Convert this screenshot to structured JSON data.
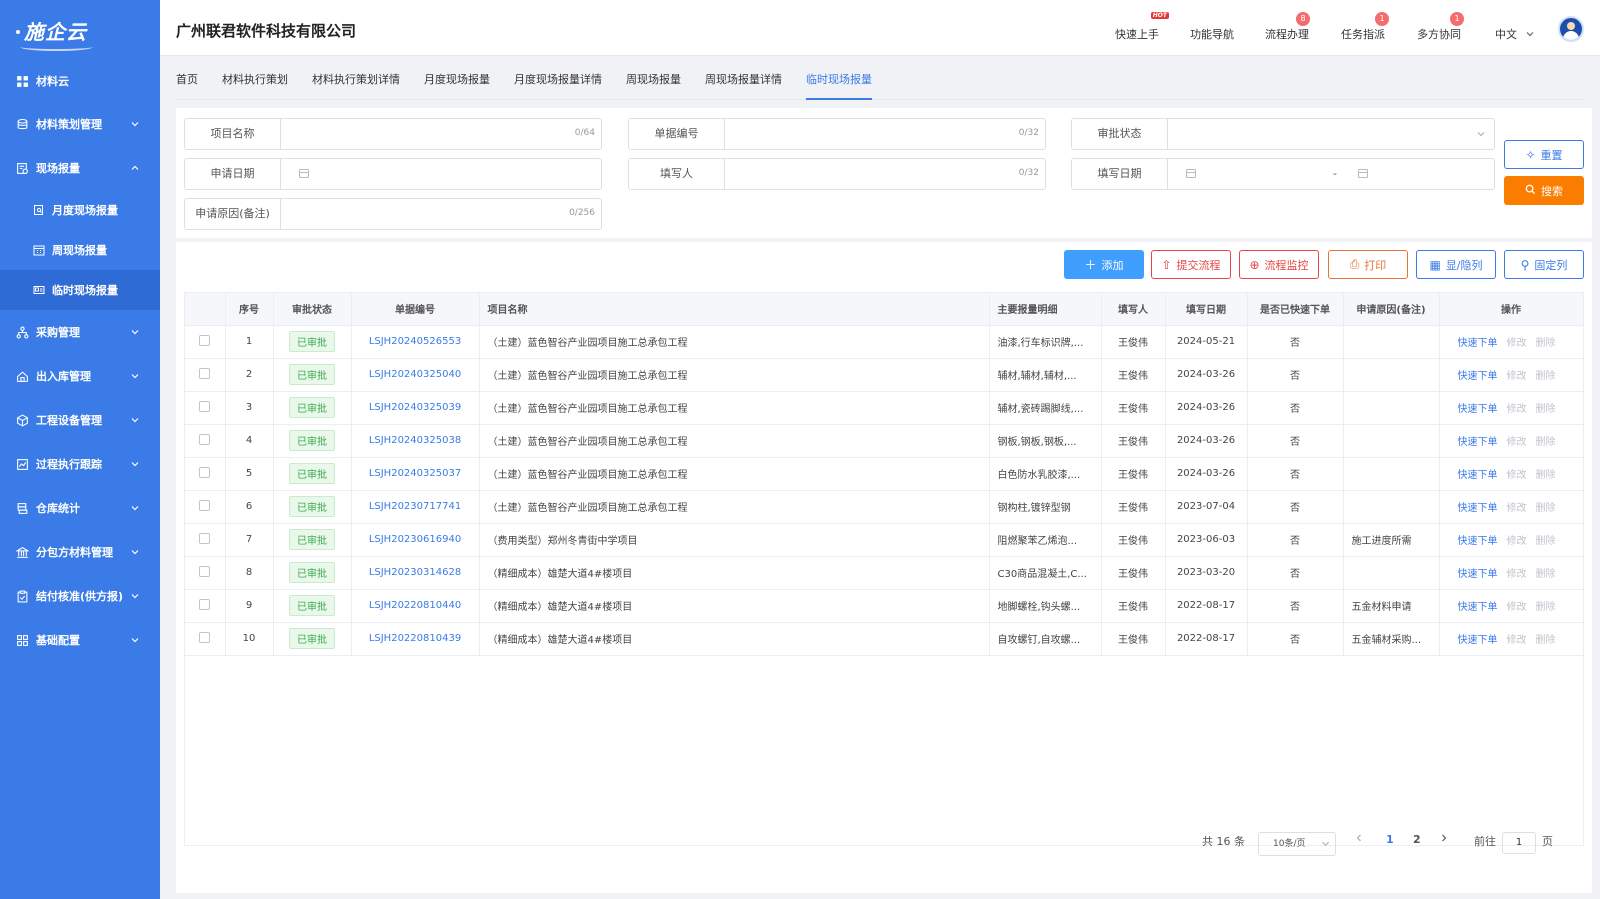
{
  "logo": {
    "text": "施企云"
  },
  "sidebar": {
    "top": {
      "label": "材料云"
    },
    "items": [
      {
        "label": "材料策划管理",
        "icon": "database-icon",
        "expanded": false
      },
      {
        "label": "现场报量",
        "icon": "report-icon",
        "expanded": true,
        "children": [
          {
            "label": "月度现场报量",
            "icon": "doc-search-icon",
            "active": false
          },
          {
            "label": "周现场报量",
            "icon": "calendar-icon",
            "active": false
          },
          {
            "label": "临时现场报量",
            "icon": "card-icon",
            "active": true
          }
        ]
      },
      {
        "label": "采购管理",
        "icon": "network-icon",
        "expanded": false
      },
      {
        "label": "出入库管理",
        "icon": "home-icon",
        "expanded": false
      },
      {
        "label": "工程设备管理",
        "icon": "cube-icon",
        "expanded": false
      },
      {
        "label": "过程执行跟踪",
        "icon": "track-icon",
        "expanded": false
      },
      {
        "label": "仓库统计",
        "icon": "stack-icon",
        "expanded": false
      },
      {
        "label": "分包方材料管理",
        "icon": "bank-icon",
        "expanded": false
      },
      {
        "label": "结付核准(供方报)",
        "icon": "clipboard-check-icon",
        "expanded": false
      },
      {
        "label": "基础配置",
        "icon": "grid-icon",
        "expanded": false
      }
    ]
  },
  "header": {
    "company": "广州联君软件科技有限公司",
    "links": [
      {
        "label": "快速上手",
        "tag": "HOT"
      },
      {
        "label": "功能导航"
      },
      {
        "label": "流程办理",
        "badge": "8"
      },
      {
        "label": "任务指派",
        "badge": "1"
      },
      {
        "label": "多方协同",
        "badge": "1"
      }
    ],
    "language": "中文"
  },
  "tabs": [
    "首页",
    "材料执行策划",
    "材料执行策划详情",
    "月度现场报量",
    "月度现场报量详情",
    "周现场报量",
    "周现场报量详情",
    "临时现场报量"
  ],
  "active_tab": 7,
  "filters": {
    "project_name": {
      "label": "项目名称",
      "count": "0/64"
    },
    "doc_no": {
      "label": "单据编号",
      "count": "0/32"
    },
    "approval_status": {
      "label": "审批状态"
    },
    "apply_date": {
      "label": "申请日期"
    },
    "filler": {
      "label": "填写人",
      "count": "0/32"
    },
    "fill_date": {
      "label": "填写日期",
      "separator": "-"
    },
    "apply_reason": {
      "label": "申请原因(备注)",
      "count": "0/256"
    },
    "reset_label": "重置",
    "search_label": "搜索"
  },
  "toolbar": {
    "add": "添加",
    "submit_flow": "提交流程",
    "flow_monitor": "流程监控",
    "print": "打印",
    "show_hide_cols": "显/隐列",
    "fix_cols": "固定列"
  },
  "table": {
    "headers": [
      "序号",
      "审批状态",
      "单据编号",
      "项目名称",
      "主要报量明细",
      "填写人",
      "填写日期",
      "是否已快速下单",
      "申请原因(备注)",
      "操作"
    ],
    "rows": [
      {
        "no": "1",
        "status": "已审批",
        "doc": "LSJH20240526553",
        "project": "（土建）蓝色智谷产业园项目施工总承包工程",
        "detail": "油漆,行车标识牌,...",
        "filler": "王俊伟",
        "date": "2024-05-21",
        "quick": "否",
        "reason": ""
      },
      {
        "no": "2",
        "status": "已审批",
        "doc": "LSJH20240325040",
        "project": "（土建）蓝色智谷产业园项目施工总承包工程",
        "detail": "辅材,辅材,辅材,...",
        "filler": "王俊伟",
        "date": "2024-03-26",
        "quick": "否",
        "reason": ""
      },
      {
        "no": "3",
        "status": "已审批",
        "doc": "LSJH20240325039",
        "project": "（土建）蓝色智谷产业园项目施工总承包工程",
        "detail": "辅材,瓷砖踢脚线,...",
        "filler": "王俊伟",
        "date": "2024-03-26",
        "quick": "否",
        "reason": ""
      },
      {
        "no": "4",
        "status": "已审批",
        "doc": "LSJH20240325038",
        "project": "（土建）蓝色智谷产业园项目施工总承包工程",
        "detail": "钢板,钢板,钢板,...",
        "filler": "王俊伟",
        "date": "2024-03-26",
        "quick": "否",
        "reason": ""
      },
      {
        "no": "5",
        "status": "已审批",
        "doc": "LSJH20240325037",
        "project": "（土建）蓝色智谷产业园项目施工总承包工程",
        "detail": "白色防水乳胶漆,...",
        "filler": "王俊伟",
        "date": "2024-03-26",
        "quick": "否",
        "reason": ""
      },
      {
        "no": "6",
        "status": "已审批",
        "doc": "LSJH20230717741",
        "project": "（土建）蓝色智谷产业园项目施工总承包工程",
        "detail": "钢构柱,镀锌型钢",
        "filler": "王俊伟",
        "date": "2023-07-04",
        "quick": "否",
        "reason": ""
      },
      {
        "no": "7",
        "status": "已审批",
        "doc": "LSJH20230616940",
        "project": "（费用类型）郑州冬青街中学项目",
        "detail": "阻燃聚苯乙烯泡...",
        "filler": "王俊伟",
        "date": "2023-06-03",
        "quick": "否",
        "reason": "施工进度所需"
      },
      {
        "no": "8",
        "status": "已审批",
        "doc": "LSJH20230314628",
        "project": "（精细成本）雄楚大道4#楼项目",
        "detail": "C30商品混凝土,C...",
        "filler": "王俊伟",
        "date": "2023-03-20",
        "quick": "否",
        "reason": ""
      },
      {
        "no": "9",
        "status": "已审批",
        "doc": "LSJH20220810440",
        "project": "（精细成本）雄楚大道4#楼项目",
        "detail": "地脚螺栓,钩头螺...",
        "filler": "王俊伟",
        "date": "2022-08-17",
        "quick": "否",
        "reason": "五金材料申请"
      },
      {
        "no": "10",
        "status": "已审批",
        "doc": "LSJH20220810439",
        "project": "（精细成本）雄楚大道4#楼项目",
        "detail": "自攻螺钉,自攻螺...",
        "filler": "王俊伟",
        "date": "2022-08-17",
        "quick": "否",
        "reason": "五金辅材采购..."
      }
    ],
    "ops": {
      "quick_order": "快速下单",
      "edit": "修改",
      "delete": "删除"
    }
  },
  "pagination": {
    "total": "共 16 条",
    "page_size": "10条/页",
    "pages": [
      "1",
      "2"
    ],
    "current": "1",
    "goto_prefix": "前往",
    "goto_value": "1",
    "goto_suffix": "页"
  },
  "colors": {
    "sidebar": "#3a7be8",
    "accent": "#3a7be8",
    "orange": "#fa7d00",
    "success": "#3bab4c",
    "danger": "#e64545"
  }
}
